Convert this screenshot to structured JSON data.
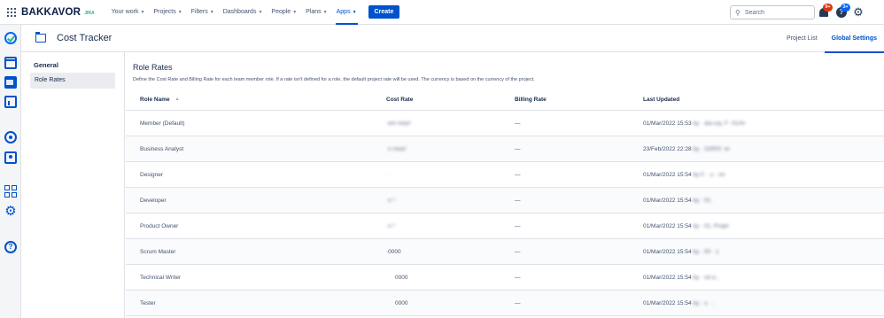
{
  "topnav": {
    "logo": "BAKKAVOR",
    "logo_sub": "JIRA",
    "menu": [
      {
        "label": "Your work",
        "chevron": true,
        "active": false
      },
      {
        "label": "Projects",
        "chevron": true,
        "active": false
      },
      {
        "label": "Filters",
        "chevron": true,
        "active": false
      },
      {
        "label": "Dashboards",
        "chevron": true,
        "active": false
      },
      {
        "label": "People",
        "chevron": true,
        "active": false
      },
      {
        "label": "Plans",
        "chevron": true,
        "active": false
      },
      {
        "label": "Apps",
        "chevron": true,
        "active": true
      }
    ],
    "create_label": "Create",
    "search_placeholder": "Search",
    "notifications_badge": "9+",
    "help_badge": "3+"
  },
  "page": {
    "title": "Cost Tracker",
    "tabs": [
      {
        "label": "Project List",
        "active": false
      },
      {
        "label": "Global Settings",
        "active": true
      }
    ]
  },
  "settings_nav": {
    "heading": "General",
    "items": [
      {
        "label": "Role Rates",
        "active": true
      }
    ]
  },
  "main": {
    "title": "Role Rates",
    "description": "Define the Cost Rate and Billing Rate for each team member role. If a rate isn't defined for a role, the default project rate will be used. The currency is based on the currency of the project.",
    "columns": [
      "Role Name",
      "Cost Rate",
      "Billing Rate",
      "Last Updated"
    ],
    "rows": [
      {
        "role": "Member (Default)",
        "cost": "·em mea³",
        "billing": "—",
        "updated": "01/Mar/2022 15:53",
        "by": "by · ata ury, F· 01/Ar"
      },
      {
        "role": "Business Analyst",
        "cost": "·n mea³",
        "billing": "—",
        "updated": "23/Feb/2022 22:28",
        "by": "by · 23/R/0 ·er"
      },
      {
        "role": "Designer",
        "cost": "·",
        "billing": "—",
        "updated": "01/Mar/2022 15:54",
        "by": "by 0 · ,v · nn"
      },
      {
        "role": "Developer",
        "cost": "·n ³",
        "billing": "—",
        "updated": "01/Mar/2022 15:54",
        "by": "by · 01·"
      },
      {
        "role": "Product Owner",
        "cost": "·n ³",
        "billing": "—",
        "updated": "01/Mar/2022 15:54",
        "by": "by · 01, Projer"
      },
      {
        "role": "Scrum Master",
        "cost": "·0000",
        "billing": "—",
        "updated": "01/Mar/2022 15:54",
        "by": "by · f/0 · 1"
      },
      {
        "role": "Technical Writer",
        "cost": "0000",
        "billing": "—",
        "updated": "01/Mar/2022 15:54",
        "by": "by · vd a·,"
      },
      {
        "role": "Tester",
        "cost": "0000",
        "billing": "—",
        "updated": "01/Mar/2022 15:54",
        "by": "by · v, · ,"
      }
    ]
  },
  "colors": {
    "accent": "#0052cc",
    "create_button": "#0052cc",
    "badge_red": "#de350b",
    "badge_blue": "#0065ff",
    "text": "#172b4d"
  },
  "icons": {
    "rail": [
      "checkmark-circle-icon",
      "calendar-icon",
      "folder-icon",
      "chart-icon",
      "globe-icon",
      "person-card-icon",
      "apps-icon",
      "settings-icon",
      "help-icon"
    ],
    "topnav": [
      "app-switcher-icon",
      "search-icon",
      "notifications-icon",
      "help-icon",
      "settings-icon"
    ]
  }
}
